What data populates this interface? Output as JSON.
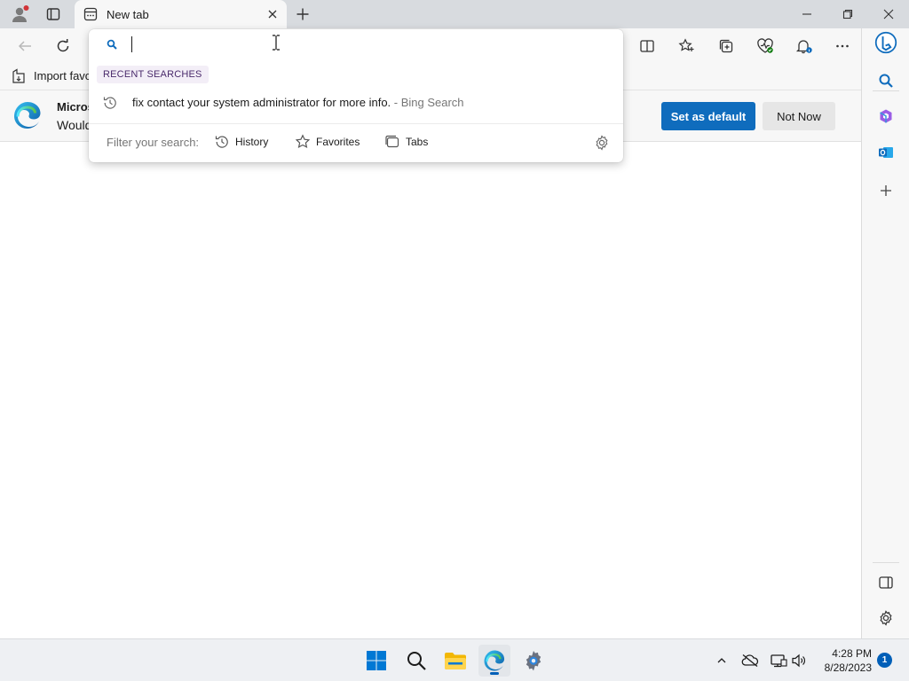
{
  "window": {
    "tab": {
      "title": "New tab"
    }
  },
  "favorites_bar": {
    "import_label": "Import favo"
  },
  "notification": {
    "title": "Micros",
    "text": "Would",
    "primary_button": "Set as default",
    "secondary_button": "Not Now"
  },
  "omnibox": {
    "input_value": "",
    "recent_header": "RECENT SEARCHES",
    "recent_items": [
      {
        "query": "fix contact your system administrator for more info.",
        "source": " - Bing Search"
      }
    ],
    "filter_label": "Filter your search:",
    "filters": [
      {
        "label": "History",
        "icon": "history-icon"
      },
      {
        "label": "Favorites",
        "icon": "star-icon"
      },
      {
        "label": "Tabs",
        "icon": "tabs-icon"
      }
    ]
  },
  "taskbar": {
    "time": "4:28 PM",
    "date": "8/28/2023",
    "notification_count": "1"
  },
  "colors": {
    "accent": "#0f6cbd",
    "tab_strip": "#d8dbdf",
    "toolbar": "#f7f7f7",
    "recent_header_bg": "#f3eef7"
  }
}
